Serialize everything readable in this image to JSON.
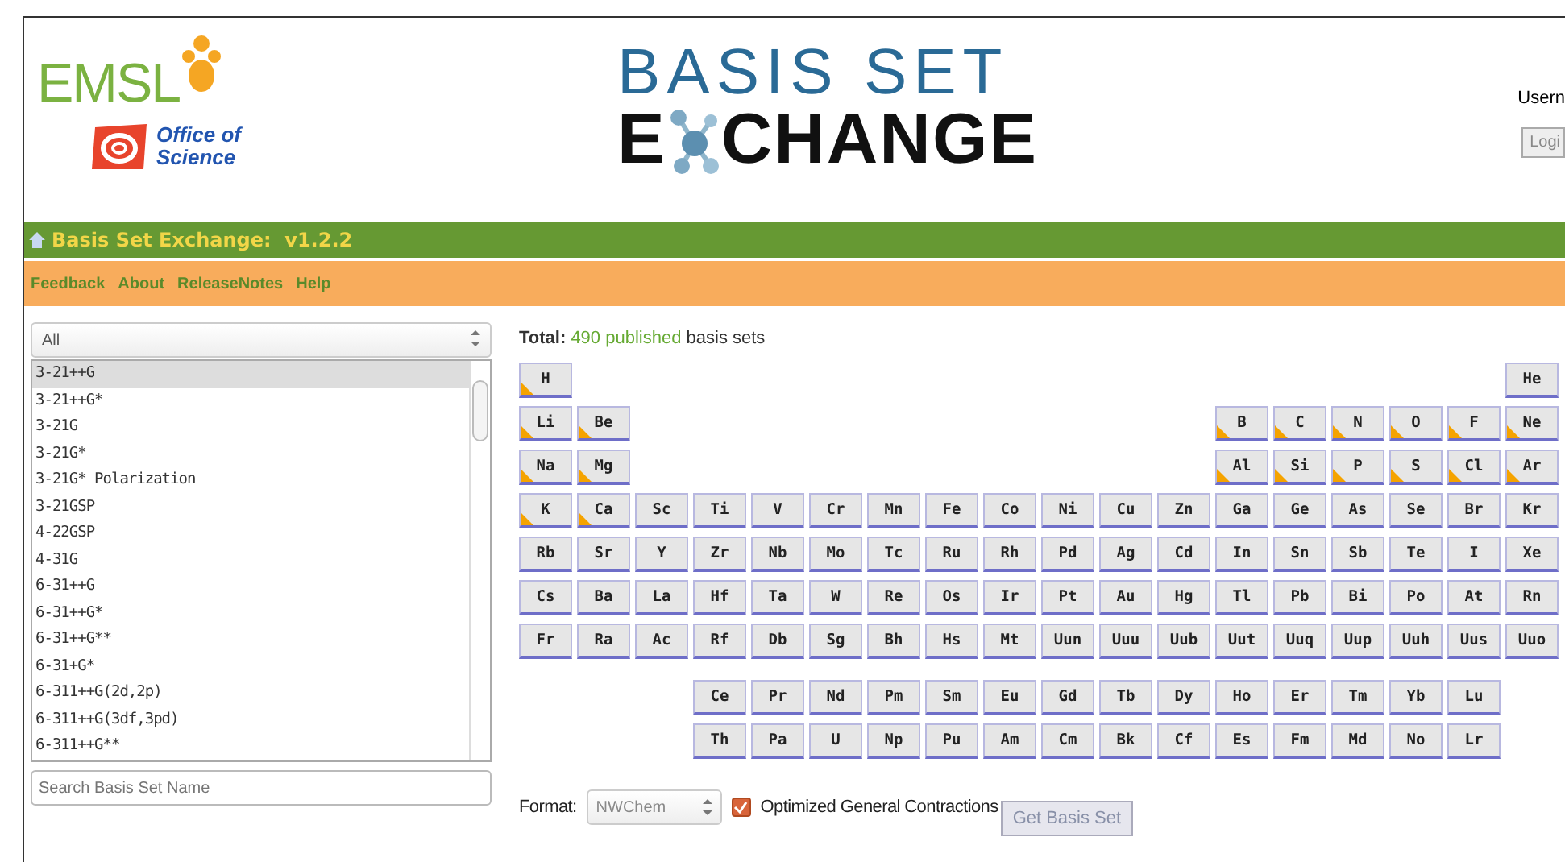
{
  "header": {
    "emsl_logo": "EMSL",
    "office_logo": "Office of Science",
    "exchange_logo": {
      "line1": "BASIS SET",
      "line2_start": "E",
      "line2_end": "CHANGE"
    },
    "user_label": "Usern",
    "login_button": "Logi"
  },
  "title_bar": {
    "title": "Basis Set Exchange:  v1.2.2"
  },
  "nav": [
    "Feedback",
    "About",
    "ReleaseNotes",
    "Help"
  ],
  "sidebar": {
    "filter": "All",
    "items": [
      {
        "label": "3-21++G",
        "selected": true
      },
      {
        "label": "3-21++G*",
        "selected": false
      },
      {
        "label": "3-21G",
        "selected": false
      },
      {
        "label": "3-21G*",
        "selected": false
      },
      {
        "label": "3-21G* Polarization",
        "selected": false
      },
      {
        "label": "3-21GSP",
        "selected": false
      },
      {
        "label": "4-22GSP",
        "selected": false
      },
      {
        "label": "4-31G",
        "selected": false
      },
      {
        "label": "6-31++G",
        "selected": false
      },
      {
        "label": "6-31++G*",
        "selected": false
      },
      {
        "label": "6-31++G**",
        "selected": false
      },
      {
        "label": "6-31+G*",
        "selected": false
      },
      {
        "label": "6-311++G(2d,2p)",
        "selected": false
      },
      {
        "label": "6-311++G(3df,3pd)",
        "selected": false
      },
      {
        "label": "6-311++G**",
        "selected": false
      }
    ],
    "search": {
      "placeholder": "Search Basis Set Name"
    }
  },
  "total": {
    "label": "Total:",
    "count": "490 published",
    "suffix": "basis sets"
  },
  "periodic_table": {
    "rows": [
      {
        "left": [
          {
            "symbol": "H",
            "flagged": true
          }
        ],
        "right": [
          {
            "symbol": "He",
            "flagged": false
          }
        ]
      },
      {
        "left": [
          {
            "symbol": "Li",
            "flagged": true
          },
          {
            "symbol": "Be",
            "flagged": true
          }
        ],
        "right": [
          {
            "symbol": "B",
            "flagged": true
          },
          {
            "symbol": "C",
            "flagged": true
          },
          {
            "symbol": "N",
            "flagged": true
          },
          {
            "symbol": "O",
            "flagged": true
          },
          {
            "symbol": "F",
            "flagged": true
          },
          {
            "symbol": "Ne",
            "flagged": true
          }
        ]
      },
      {
        "left": [
          {
            "symbol": "Na",
            "flagged": true
          },
          {
            "symbol": "Mg",
            "flagged": true
          }
        ],
        "right": [
          {
            "symbol": "Al",
            "flagged": true
          },
          {
            "symbol": "Si",
            "flagged": true
          },
          {
            "symbol": "P",
            "flagged": true
          },
          {
            "symbol": "S",
            "flagged": true
          },
          {
            "symbol": "Cl",
            "flagged": true
          },
          {
            "symbol": "Ar",
            "flagged": true
          }
        ]
      },
      {
        "left": [
          {
            "symbol": "K",
            "flagged": true
          },
          {
            "symbol": "Ca",
            "flagged": true
          },
          {
            "symbol": "Sc",
            "flagged": false
          },
          {
            "symbol": "Ti",
            "flagged": false
          },
          {
            "symbol": "V",
            "flagged": false
          },
          {
            "symbol": "Cr",
            "flagged": false
          },
          {
            "symbol": "Mn",
            "flagged": false
          },
          {
            "symbol": "Fe",
            "flagged": false
          },
          {
            "symbol": "Co",
            "flagged": false
          },
          {
            "symbol": "Ni",
            "flagged": false
          },
          {
            "symbol": "Cu",
            "flagged": false
          },
          {
            "symbol": "Zn",
            "flagged": false
          },
          {
            "symbol": "Ga",
            "flagged": false
          },
          {
            "symbol": "Ge",
            "flagged": false
          },
          {
            "symbol": "As",
            "flagged": false
          },
          {
            "symbol": "Se",
            "flagged": false
          },
          {
            "symbol": "Br",
            "flagged": false
          },
          {
            "symbol": "Kr",
            "flagged": false
          }
        ],
        "right": []
      },
      {
        "left": [
          {
            "symbol": "Rb",
            "flagged": false
          },
          {
            "symbol": "Sr",
            "flagged": false
          },
          {
            "symbol": "Y",
            "flagged": false
          },
          {
            "symbol": "Zr",
            "flagged": false
          },
          {
            "symbol": "Nb",
            "flagged": false
          },
          {
            "symbol": "Mo",
            "flagged": false
          },
          {
            "symbol": "Tc",
            "flagged": false
          },
          {
            "symbol": "Ru",
            "flagged": false
          },
          {
            "symbol": "Rh",
            "flagged": false
          },
          {
            "symbol": "Pd",
            "flagged": false
          },
          {
            "symbol": "Ag",
            "flagged": false
          },
          {
            "symbol": "Cd",
            "flagged": false
          },
          {
            "symbol": "In",
            "flagged": false
          },
          {
            "symbol": "Sn",
            "flagged": false
          },
          {
            "symbol": "Sb",
            "flagged": false
          },
          {
            "symbol": "Te",
            "flagged": false
          },
          {
            "symbol": "I",
            "flagged": false
          },
          {
            "symbol": "Xe",
            "flagged": false
          }
        ],
        "right": []
      },
      {
        "left": [
          {
            "symbol": "Cs",
            "flagged": false
          },
          {
            "symbol": "Ba",
            "flagged": false
          },
          {
            "symbol": "La",
            "flagged": false
          },
          {
            "symbol": "Hf",
            "flagged": false
          },
          {
            "symbol": "Ta",
            "flagged": false
          },
          {
            "symbol": "W",
            "flagged": false
          },
          {
            "symbol": "Re",
            "flagged": false
          },
          {
            "symbol": "Os",
            "flagged": false
          },
          {
            "symbol": "Ir",
            "flagged": false
          },
          {
            "symbol": "Pt",
            "flagged": false
          },
          {
            "symbol": "Au",
            "flagged": false
          },
          {
            "symbol": "Hg",
            "flagged": false
          },
          {
            "symbol": "Tl",
            "flagged": false
          },
          {
            "symbol": "Pb",
            "flagged": false
          },
          {
            "symbol": "Bi",
            "flagged": false
          },
          {
            "symbol": "Po",
            "flagged": false
          },
          {
            "symbol": "At",
            "flagged": false
          },
          {
            "symbol": "Rn",
            "flagged": false
          }
        ],
        "right": []
      },
      {
        "left": [
          {
            "symbol": "Fr",
            "flagged": false
          },
          {
            "symbol": "Ra",
            "flagged": false
          },
          {
            "symbol": "Ac",
            "flagged": false
          },
          {
            "symbol": "Rf",
            "flagged": false
          },
          {
            "symbol": "Db",
            "flagged": false
          },
          {
            "symbol": "Sg",
            "flagged": false
          },
          {
            "symbol": "Bh",
            "flagged": false
          },
          {
            "symbol": "Hs",
            "flagged": false
          },
          {
            "symbol": "Mt",
            "flagged": false
          },
          {
            "symbol": "Uun",
            "flagged": false
          },
          {
            "symbol": "Uuu",
            "flagged": false
          },
          {
            "symbol": "Uub",
            "flagged": false
          },
          {
            "symbol": "Uut",
            "flagged": false
          },
          {
            "symbol": "Uuq",
            "flagged": false
          },
          {
            "symbol": "Uup",
            "flagged": false
          },
          {
            "symbol": "Uuh",
            "flagged": false
          },
          {
            "symbol": "Uus",
            "flagged": false
          },
          {
            "symbol": "Uuo",
            "flagged": false
          }
        ],
        "right": []
      }
    ],
    "f_block": [
      [
        {
          "symbol": "Ce",
          "flagged": false
        },
        {
          "symbol": "Pr",
          "flagged": false
        },
        {
          "symbol": "Nd",
          "flagged": false
        },
        {
          "symbol": "Pm",
          "flagged": false
        },
        {
          "symbol": "Sm",
          "flagged": false
        },
        {
          "symbol": "Eu",
          "flagged": false
        },
        {
          "symbol": "Gd",
          "flagged": false
        },
        {
          "symbol": "Tb",
          "flagged": false
        },
        {
          "symbol": "Dy",
          "flagged": false
        },
        {
          "symbol": "Ho",
          "flagged": false
        },
        {
          "symbol": "Er",
          "flagged": false
        },
        {
          "symbol": "Tm",
          "flagged": false
        },
        {
          "symbol": "Yb",
          "flagged": false
        },
        {
          "symbol": "Lu",
          "flagged": false
        }
      ],
      [
        {
          "symbol": "Th",
          "flagged": false
        },
        {
          "symbol": "Pa",
          "flagged": false
        },
        {
          "symbol": "U",
          "flagged": false
        },
        {
          "symbol": "Np",
          "flagged": false
        },
        {
          "symbol": "Pu",
          "flagged": false
        },
        {
          "symbol": "Am",
          "flagged": false
        },
        {
          "symbol": "Cm",
          "flagged": false
        },
        {
          "symbol": "Bk",
          "flagged": false
        },
        {
          "symbol": "Cf",
          "flagged": false
        },
        {
          "symbol": "Es",
          "flagged": false
        },
        {
          "symbol": "Fm",
          "flagged": false
        },
        {
          "symbol": "Md",
          "flagged": false
        },
        {
          "symbol": "No",
          "flagged": false
        },
        {
          "symbol": "Lr",
          "flagged": false
        }
      ]
    ]
  },
  "options": {
    "format_label": "Format:",
    "format_value": "NWChem",
    "optimized": {
      "label": "Optimized General Contractions",
      "checked": true
    },
    "get_button": {
      "label": "Get Basis Set",
      "disabled": true
    }
  }
}
